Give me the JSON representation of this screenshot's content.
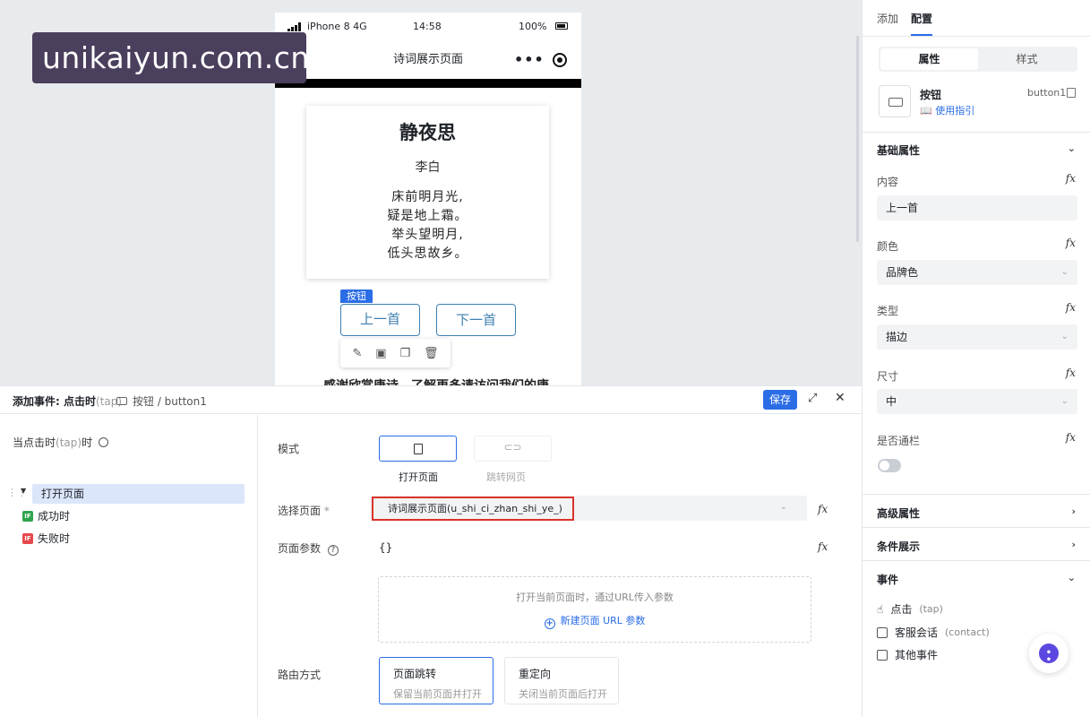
{
  "watermark": "unikaiyun.com.cn",
  "phone": {
    "carrier": "iPhone 8  4G",
    "time": "14:58",
    "battery": "100%",
    "nav_title": "诗词展示页面",
    "more_icon": "more-dots-icon",
    "target_icon": "record-target-icon"
  },
  "poem": {
    "title": "静夜思",
    "author": "李白",
    "lines": [
      "床前明月光,",
      "疑是地上霜。",
      "举头望明月,",
      "低头思故乡。"
    ]
  },
  "selection_tag": "按钮",
  "buttons": {
    "prev": "上一首",
    "next": "下一首"
  },
  "float_toolbar": [
    "edit-icon",
    "save-icon",
    "copy-icon",
    "delete-icon"
  ],
  "bottom_text": "感谢欣赏唐诗，了解更多请访问我们的唐",
  "right_panel": {
    "tabs": [
      "添加",
      "配置"
    ],
    "segments": [
      "属性",
      "样式"
    ],
    "component_name": "按钮",
    "component_id": "button1",
    "guide_link": "使用指引",
    "basic_section": "基础属性",
    "fields": {
      "content_label": "内容",
      "content_value": "上一首",
      "color_label": "颜色",
      "color_value": "品牌色",
      "type_label": "类型",
      "type_value": "描边",
      "size_label": "尺寸",
      "size_value": "中",
      "block_label": "是否通栏"
    },
    "fx_label": "fx",
    "advanced_section": "高级属性",
    "condition_section": "条件展示",
    "events_section": "事件",
    "events": [
      {
        "label": "点击",
        "sub": "(tap)"
      },
      {
        "label": "客服会话",
        "sub": "(contact)"
      },
      {
        "label": "其他事件",
        "sub": ""
      }
    ]
  },
  "event_panel": {
    "title": "添加事件: 点击时",
    "title_sub": "(tap)",
    "component_path": "按钮 / button1",
    "save": "保存",
    "trigger": {
      "label": "当点击时",
      "sub": "(tap)",
      "suffix": "时"
    },
    "action": "打开页面",
    "branches": [
      {
        "badge": "IF",
        "label": "成功时",
        "color": "#2ea44f"
      },
      {
        "badge": "IF",
        "label": "失败时",
        "color": "#e5484d"
      }
    ],
    "mode_label": "模式",
    "mode_options": [
      "打开页面",
      "跳转网页"
    ],
    "select_page_label": "选择页面",
    "required_mark": "*",
    "selected_page": "诗词展示页面(u_shi_ci_zhan_shi_ye_)",
    "params_label": "页面参数",
    "params_value": "{}",
    "params_hint": "打开当前页面时，通过URL传入参数",
    "params_add": "新建页面 URL 参数",
    "route_label": "路由方式",
    "route_options": [
      {
        "title": "页面跳转",
        "desc": "保留当前页面并打开"
      },
      {
        "title": "重定向",
        "desc": "关闭当前页面后打开"
      }
    ]
  },
  "colors": {
    "accent": "#2b6de6",
    "highlight_border": "#d9342b",
    "button_outline": "#3d7fb0"
  }
}
